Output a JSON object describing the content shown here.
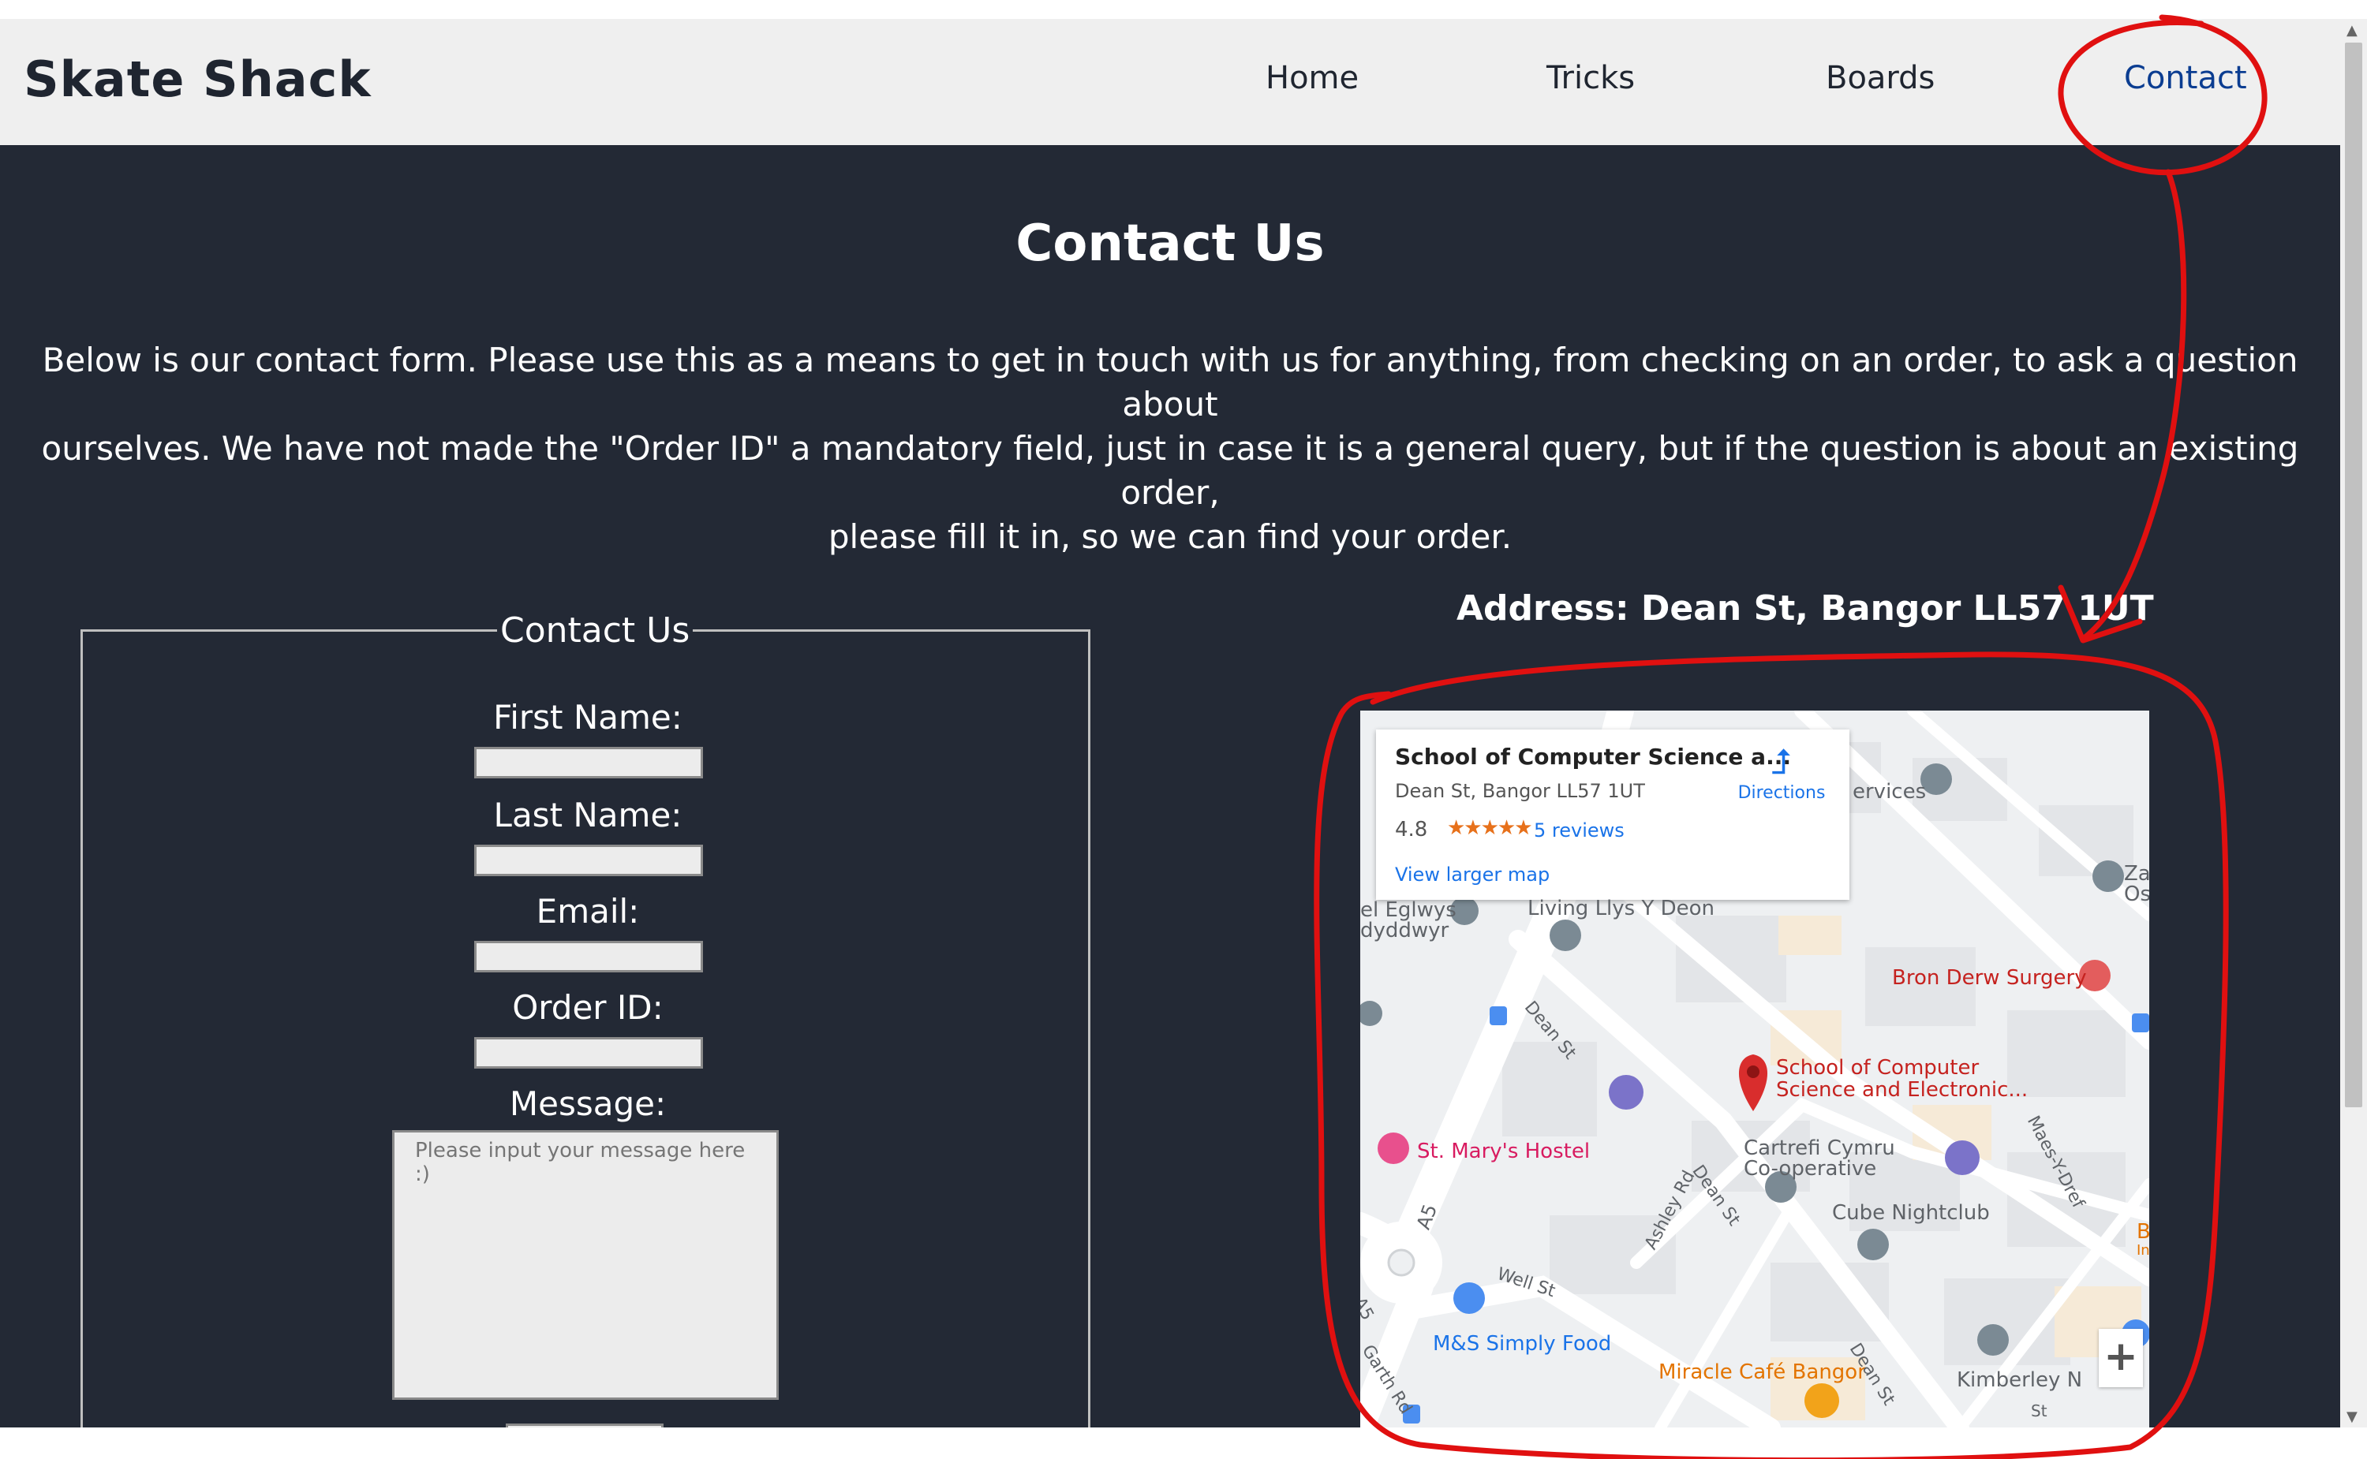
{
  "nav": {
    "brand": "Skate Shack",
    "links": [
      "Home",
      "Tricks",
      "Boards",
      "Contact"
    ]
  },
  "page": {
    "title": "Contact Us",
    "intro_lines": [
      "Below is our contact form. Please use this as a means to get in touch with us for anything, from checking on an order, to ask a question about",
      "ourselves. We have not made the \"Order ID\" a mandatory field, just in case it is a general query, but if the question is about an existing order,",
      "please fill it in, so we can find your order."
    ]
  },
  "form": {
    "legend": "Contact Us",
    "first_name_label": "First Name:",
    "last_name_label": "Last Name:",
    "email_label": "Email:",
    "order_id_label": "Order ID:",
    "message_label": "Message:",
    "message_placeholder": "Please input your message here :)"
  },
  "address": "Address: Dean St, Bangor LL57 1UT",
  "map": {
    "card": {
      "title": "School of Computer Science a...",
      "address": "Dean St, Bangor LL57 1UT",
      "rating": "4.8",
      "stars": "★★★★★",
      "reviews": "5 reviews",
      "directions": "Directions",
      "larger_map": "View larger map"
    },
    "labels": {
      "services": "ervices",
      "za": "Za",
      "os": "Os",
      "eglwys": "el Eglwys",
      "dyddwyr": "dyddwyr",
      "living": "Living Llys Y Deon",
      "bron": "Bron Derw Surgery",
      "dean1": "Dean St",
      "school1": "School of Computer",
      "school2": "Science and Electronic...",
      "maes": "Maes-Y-Dref",
      "marys": "St. Mary's Hostel",
      "cartrefi1": "Cartrefi Cymru",
      "cartrefi2": "Co-operative",
      "ashley": "Ashley Rd",
      "dean2": "Dean St",
      "a5a": "A5",
      "cube": "Cube Nightclub",
      "well": "Well St",
      "a5b": "A5",
      "ms": "M&S Simply Food",
      "garth": "Garth Rd",
      "miracle": "Miracle Café Bangor",
      "dean3": "Dean St",
      "kimberley": "Kimberley N",
      "st": "St",
      "b_edge": "B",
      "in_edge": "In"
    },
    "zoom_in": "+"
  }
}
